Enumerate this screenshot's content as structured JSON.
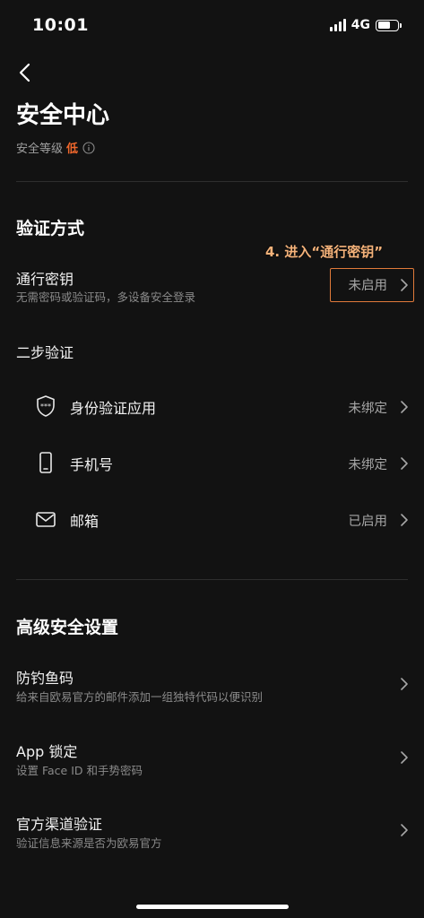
{
  "status_bar": {
    "time": "10:01",
    "network": "4G"
  },
  "header": {
    "title": "安全中心",
    "level_label": "安全等级",
    "level_value": "低"
  },
  "verify": {
    "title": "验证方式",
    "passkey": {
      "title": "通行密钥",
      "subtitle": "无需密码或验证码，多设备安全登录",
      "status": "未启用"
    },
    "two_step": {
      "title": "二步验证",
      "items": [
        {
          "label": "身份验证应用",
          "status": "未绑定",
          "icon": "shield-icon"
        },
        {
          "label": "手机号",
          "status": "未绑定",
          "icon": "phone-icon"
        },
        {
          "label": "邮箱",
          "status": "已启用",
          "icon": "mail-icon"
        }
      ]
    }
  },
  "advanced": {
    "title": "高级安全设置",
    "items": [
      {
        "title": "防钓鱼码",
        "subtitle": "给来自欧易官方的邮件添加一组独特代码以便识别"
      },
      {
        "title": "App 锁定",
        "subtitle": "设置 Face ID 和手势密码"
      },
      {
        "title": "官方渠道验证",
        "subtitle": "验证信息来源是否为欧易官方"
      }
    ]
  },
  "annotation": "4. 进入“通行密钥”",
  "colors": {
    "background": "#121212",
    "accent": "#f0672c",
    "annotation_box": "#e07a3a"
  }
}
